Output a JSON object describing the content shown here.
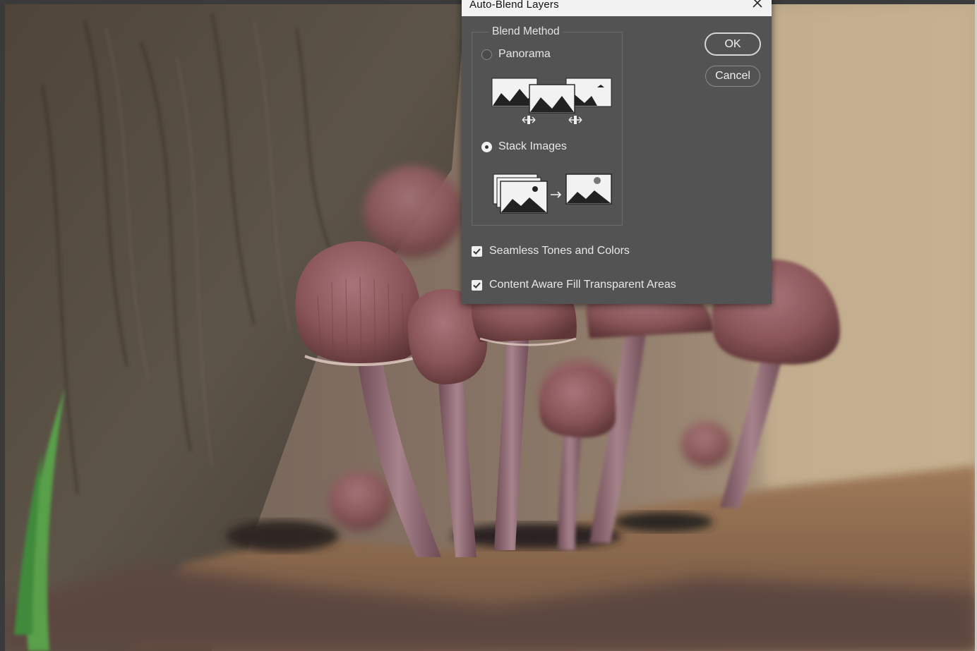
{
  "dialog": {
    "title": "Auto-Blend Layers",
    "close_icon": "close-icon",
    "blend_method_label": "Blend Method",
    "options": [
      {
        "label": "Panorama",
        "checked": false,
        "illustration": "panorama-illustration-icon"
      },
      {
        "label": "Stack Images",
        "checked": true,
        "illustration": "stack-images-illustration-icon"
      }
    ],
    "checkboxes": [
      {
        "label": "Seamless Tones and Colors",
        "checked": true
      },
      {
        "label": "Content Aware Fill Transparent Areas",
        "checked": true
      }
    ],
    "ok_label": "OK",
    "cancel_label": "Cancel"
  },
  "colors": {
    "dialog_bg": "#535353",
    "titlebar_bg": "#f2f2f2",
    "text": "#e8e8e8"
  }
}
